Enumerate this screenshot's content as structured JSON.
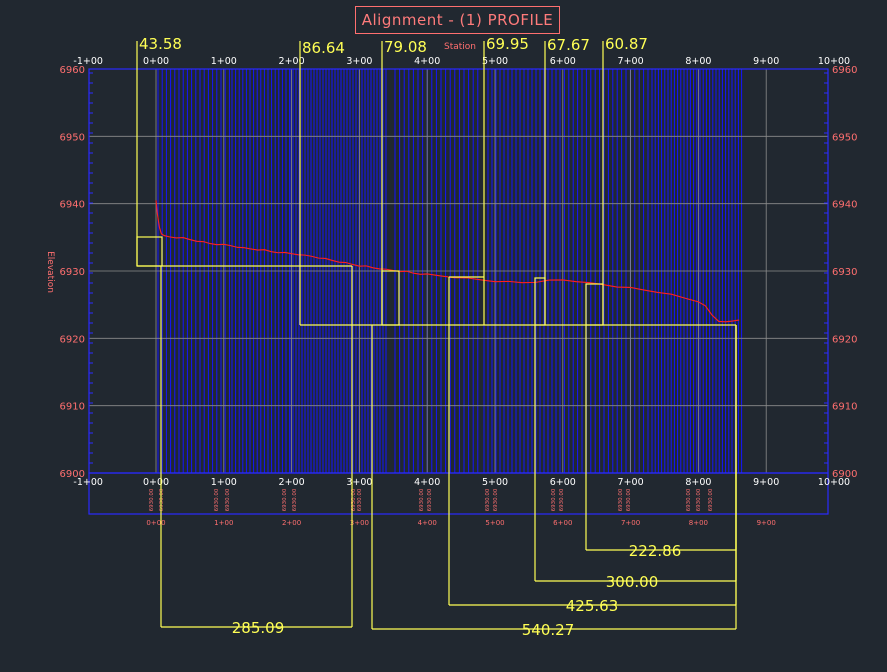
{
  "title": "Alignment - (1) PROFILE",
  "axes": {
    "x_label": "Station",
    "y_label": "Elevation",
    "station_ticks": [
      "-1+00",
      "0+00",
      "1+00",
      "2+00",
      "3+00",
      "4+00",
      "5+00",
      "6+00",
      "7+00",
      "8+00",
      "9+00",
      "10+00"
    ],
    "bottom_ticks": [
      "-1+00",
      "0+00",
      "1+00",
      "2+00",
      "3+00",
      "4+00",
      "5+00",
      "6+00",
      "7+00",
      "8+00",
      "9+00",
      "10+00"
    ],
    "band_ticks": [
      "0+00",
      "1+00",
      "2+00",
      "3+00",
      "4+00",
      "5+00",
      "6+00",
      "7+00",
      "8+00",
      "9+00"
    ],
    "elevation_ticks": [
      "6900",
      "6910",
      "6920",
      "6930",
      "6940",
      "6950",
      "6960"
    ]
  },
  "dimensions_top": [
    "43.58",
    "86.64",
    "79.08",
    "69.95",
    "67.67",
    "60.87"
  ],
  "dimensions_bottom": [
    "285.09",
    "540.27",
    "425.63",
    "300.00",
    "222.86"
  ],
  "colors": {
    "background": "#212830",
    "grid": "#8c8c8c",
    "frame": "#2a2aff",
    "hatch": "#1414ff",
    "profile": "#ff2020",
    "dimension": "#ffff55",
    "label": "#ff6f6f"
  },
  "chart_data": {
    "type": "line",
    "title": "Alignment - (1) PROFILE",
    "xlabel": "Station",
    "ylabel": "Elevation",
    "xlim": [
      -100,
      1000
    ],
    "ylim": [
      6900,
      6960
    ],
    "grid": true,
    "series": [
      {
        "x": [
          0,
          2,
          5,
          8,
          12,
          20,
          30,
          40,
          50,
          60,
          70,
          80,
          90,
          100,
          110,
          120,
          130,
          140,
          150,
          160,
          170,
          180,
          190,
          200,
          210,
          220,
          230,
          240,
          250,
          260,
          270,
          280,
          290,
          300,
          310,
          320,
          330,
          340,
          350,
          360,
          370,
          380,
          390,
          400,
          420,
          440,
          460,
          480,
          500,
          520,
          540,
          560,
          580,
          600,
          620,
          640,
          660,
          680,
          700,
          720,
          740,
          760,
          780,
          800,
          810,
          820,
          830,
          840,
          850,
          860
        ],
        "y": [
          6940.5,
          6938.5,
          6936.5,
          6935.6,
          6935.2,
          6935.1,
          6935.0,
          6934.9,
          6934.7,
          6934.5,
          6934.3,
          6934.1,
          6934.0,
          6933.9,
          6933.8,
          6933.6,
          6933.4,
          6933.3,
          6933.2,
          6933.1,
          6932.9,
          6932.8,
          6932.7,
          6932.6,
          6932.5,
          6932.3,
          6932.2,
          6932.0,
          6931.8,
          6931.6,
          6931.4,
          6931.2,
          6931.0,
          6930.8,
          6930.7,
          6930.5,
          6930.4,
          6930.2,
          6930.1,
          6930.0,
          6929.9,
          6929.7,
          6929.6,
          6929.5,
          6929.3,
          6929.1,
          6928.9,
          6928.7,
          6928.5,
          6928.4,
          6928.3,
          6928.4,
          6928.6,
          6928.7,
          6928.5,
          6928.2,
          6928.0,
          6927.7,
          6927.5,
          6927.2,
          6926.9,
          6926.5,
          6926.0,
          6925.5,
          6924.8,
          6923.5,
          6922.6,
          6922.4,
          6922.6,
          6922.8
        ]
      }
    ]
  }
}
